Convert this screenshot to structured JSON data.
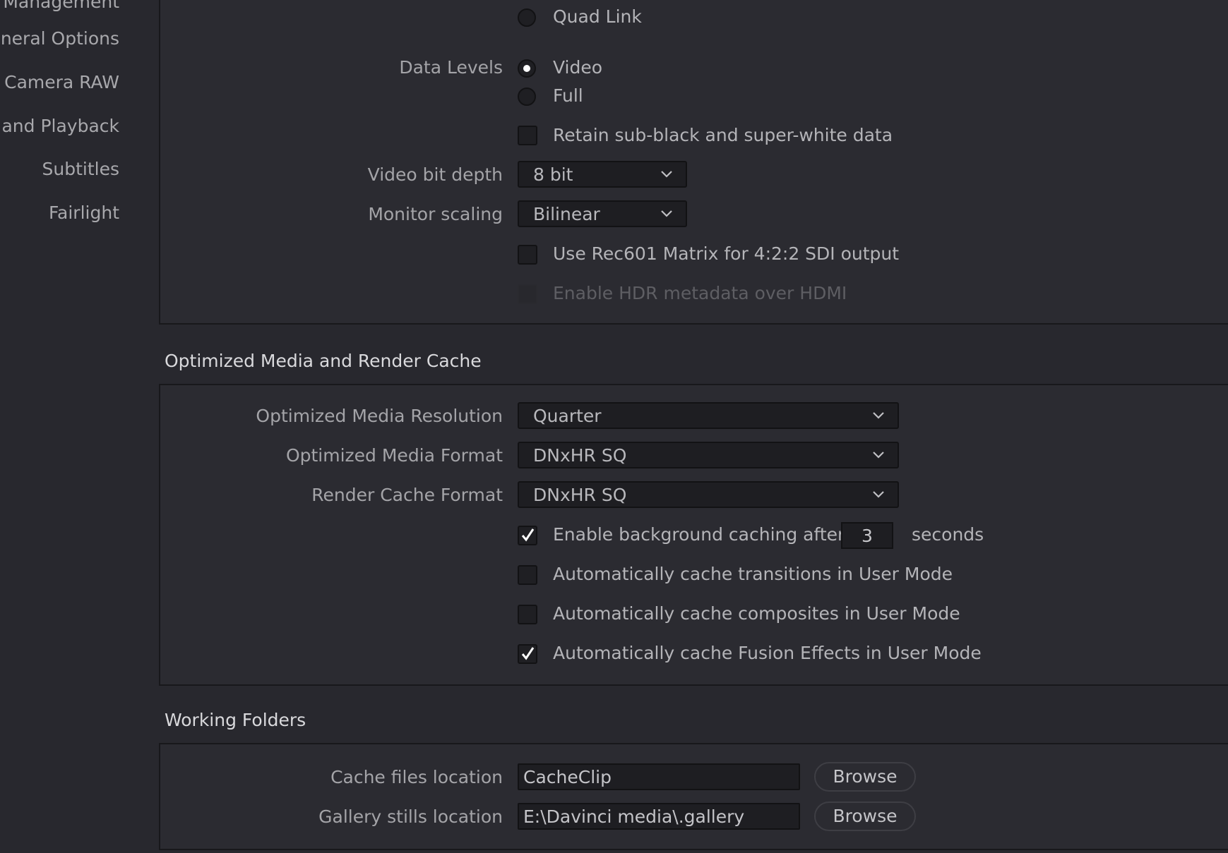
{
  "sidebar": {
    "items": [
      {
        "label": "Management"
      },
      {
        "label": "eneral Options"
      },
      {
        "label": "Camera RAW"
      },
      {
        "label": "e and Playback"
      },
      {
        "label": "Subtitles"
      },
      {
        "label": "Fairlight"
      }
    ]
  },
  "video_monitoring": {
    "link_options": [
      {
        "label": "Quad Link",
        "selected": false
      }
    ],
    "data_levels": {
      "label": "Data Levels",
      "options": [
        {
          "label": "Video",
          "selected": true
        },
        {
          "label": "Full",
          "selected": false
        }
      ]
    },
    "retain_sub_black": {
      "label": "Retain sub-black and super-white data",
      "checked": false
    },
    "video_bit_depth": {
      "label": "Video bit depth",
      "value": "8 bit"
    },
    "monitor_scaling": {
      "label": "Monitor scaling",
      "value": "Bilinear"
    },
    "use_rec601": {
      "label": "Use Rec601 Matrix for 4:2:2 SDI output",
      "checked": false
    },
    "enable_hdr_metadata": {
      "label": "Enable HDR metadata over HDMI",
      "checked": false,
      "disabled": true
    }
  },
  "optimized_media": {
    "title": "Optimized Media and Render Cache",
    "resolution": {
      "label": "Optimized Media Resolution",
      "value": "Quarter"
    },
    "format": {
      "label": "Optimized Media Format",
      "value": "DNxHR SQ"
    },
    "render_cache_format": {
      "label": "Render Cache Format",
      "value": "DNxHR SQ"
    },
    "background_caching": {
      "label": "Enable background caching after",
      "checked": true,
      "seconds": "3",
      "unit": "seconds"
    },
    "cache_transitions": {
      "label": "Automatically cache transitions in User Mode",
      "checked": false
    },
    "cache_composites": {
      "label": "Automatically cache composites in User Mode",
      "checked": false
    },
    "cache_fusion": {
      "label": "Automatically cache Fusion Effects in User Mode",
      "checked": true
    }
  },
  "working_folders": {
    "title": "Working Folders",
    "cache_files": {
      "label": "Cache files location",
      "value": "CacheClip",
      "button": "Browse"
    },
    "gallery_stills": {
      "label": "Gallery stills location",
      "value": "E:\\Davinci media\\.gallery",
      "button": "Browse"
    }
  },
  "colors": {
    "background": "#28282e",
    "panel": "#2b2b31",
    "border": "#18181b",
    "text": "#b4b4b8",
    "check": "#ffffff"
  }
}
